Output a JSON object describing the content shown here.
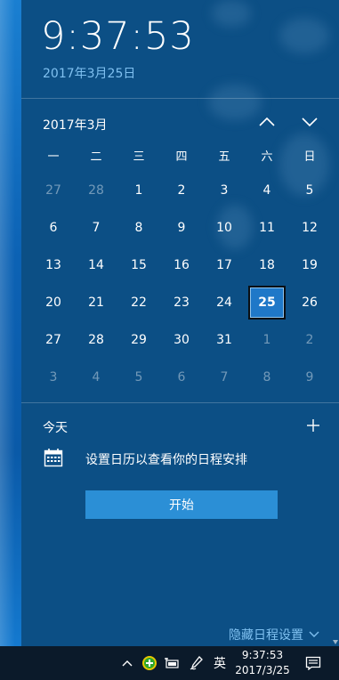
{
  "flyout": {
    "clock": "9:37:53",
    "full_date": "2017年3月25日",
    "month_title": "2017年3月",
    "weekdays": [
      "一",
      "二",
      "三",
      "四",
      "五",
      "六",
      "日"
    ],
    "weeks": [
      [
        {
          "d": "27",
          "o": true
        },
        {
          "d": "28",
          "o": true
        },
        {
          "d": "1"
        },
        {
          "d": "2"
        },
        {
          "d": "3"
        },
        {
          "d": "4"
        },
        {
          "d": "5"
        }
      ],
      [
        {
          "d": "6"
        },
        {
          "d": "7"
        },
        {
          "d": "8"
        },
        {
          "d": "9"
        },
        {
          "d": "10"
        },
        {
          "d": "11"
        },
        {
          "d": "12"
        }
      ],
      [
        {
          "d": "13"
        },
        {
          "d": "14"
        },
        {
          "d": "15"
        },
        {
          "d": "16"
        },
        {
          "d": "17"
        },
        {
          "d": "18"
        },
        {
          "d": "19"
        }
      ],
      [
        {
          "d": "20"
        },
        {
          "d": "21"
        },
        {
          "d": "22"
        },
        {
          "d": "23"
        },
        {
          "d": "24"
        },
        {
          "d": "25",
          "t": true
        },
        {
          "d": "26"
        }
      ],
      [
        {
          "d": "27"
        },
        {
          "d": "28"
        },
        {
          "d": "29"
        },
        {
          "d": "30"
        },
        {
          "d": "31"
        },
        {
          "d": "1",
          "o": true
        },
        {
          "d": "2",
          "o": true
        }
      ],
      [
        {
          "d": "3",
          "o": true
        },
        {
          "d": "4",
          "o": true
        },
        {
          "d": "5",
          "o": true
        },
        {
          "d": "6",
          "o": true
        },
        {
          "d": "7",
          "o": true
        },
        {
          "d": "8",
          "o": true
        },
        {
          "d": "9",
          "o": true
        }
      ]
    ],
    "today_label": "今天",
    "event_text": "设置日历以查看你的日程安排",
    "start_button": "开始",
    "hide_agenda": "隐藏日程设置",
    "accent_color": "#2b8fd6",
    "link_color": "#7fc0f0"
  },
  "taskbar": {
    "ime_label": "英",
    "time": "9:37:53",
    "date": "2017/3/25",
    "icons": [
      "chevron-up-icon",
      "security-shield-icon",
      "battery-icon",
      "pen-icon",
      "action-center-icon"
    ]
  }
}
